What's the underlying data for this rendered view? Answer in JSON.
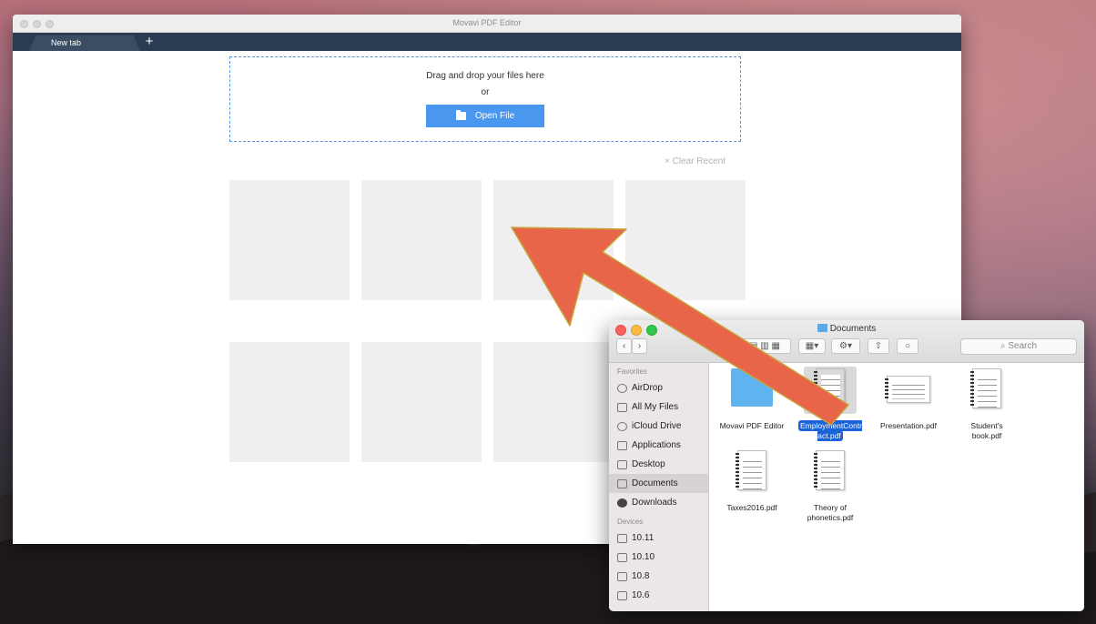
{
  "app": {
    "window_title": "Movavi PDF Editor",
    "tab_label": "New tab",
    "new_tab_symbol": "+"
  },
  "dropzone": {
    "title": "Drag and drop your files here",
    "or": "or",
    "open_label": "Open File"
  },
  "recent": {
    "clear_label": "× Clear Recent"
  },
  "finder": {
    "title": "Documents",
    "search_placeholder": "Search",
    "sidebar": {
      "favorites_heading": "Favorites",
      "favorites": [
        {
          "label": "AirDrop",
          "icon": "airdrop-icon"
        },
        {
          "label": "All My Files",
          "icon": "all-files-icon"
        },
        {
          "label": "iCloud Drive",
          "icon": "cloud-icon"
        },
        {
          "label": "Applications",
          "icon": "applications-icon"
        },
        {
          "label": "Desktop",
          "icon": "desktop-icon"
        },
        {
          "label": "Documents",
          "icon": "documents-icon",
          "selected": true
        },
        {
          "label": "Downloads",
          "icon": "downloads-icon"
        }
      ],
      "devices_heading": "Devices",
      "devices": [
        {
          "label": "10.11"
        },
        {
          "label": "10.10"
        },
        {
          "label": "10.8"
        },
        {
          "label": "10.6"
        }
      ]
    },
    "files": [
      {
        "name": "Movavi PDF Editor",
        "kind": "folder"
      },
      {
        "name": "EmploymentContract.pdf",
        "kind": "pdf-portrait",
        "selected": true,
        "line1": "EmploymentContr",
        "line2": "act.pdf"
      },
      {
        "name": "Presentation.pdf",
        "kind": "pdf-landscape"
      },
      {
        "name": "Student's book.pdf",
        "kind": "pdf-portrait",
        "line1": "Student's",
        "line2": "book.pdf"
      },
      {
        "name": "Taxes2016.pdf",
        "kind": "pdf-portrait"
      },
      {
        "name": "Theory of phonetics.pdf",
        "kind": "pdf-portrait",
        "line1": "Theory of",
        "line2": "phonetics.pdf"
      }
    ]
  },
  "colors": {
    "accent": "#4a97ef",
    "tabbar": "#2a3c52",
    "arrow": "#e8654a",
    "selection": "#1a63d8"
  }
}
